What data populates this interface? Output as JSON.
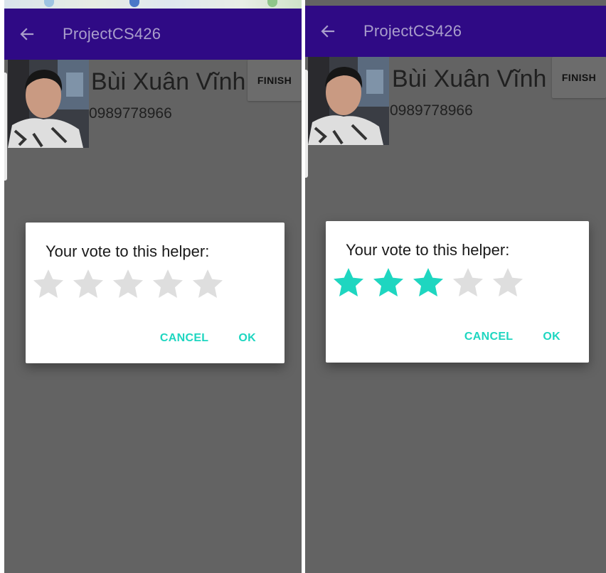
{
  "app": {
    "title": "ProjectCS426"
  },
  "helper": {
    "name": "Bùi Xuân Vĩnh",
    "phone": "0989778966",
    "finish_label": "FINISH"
  },
  "vote_dialog": {
    "title": "Your vote to this helper:",
    "cancel_label": "CANCEL",
    "ok_label": "OK",
    "max_stars": 5
  },
  "screens": [
    {
      "rating": 0
    },
    {
      "rating": 3
    }
  ],
  "colors": {
    "app_bar": "#2f0a85",
    "app_title": "#a99ecb",
    "accent": "#1ed6c0",
    "star_empty": "#dedede",
    "scrim_background": "#636363"
  },
  "icons": {
    "back": "arrow-left-icon",
    "star": "star-icon"
  }
}
